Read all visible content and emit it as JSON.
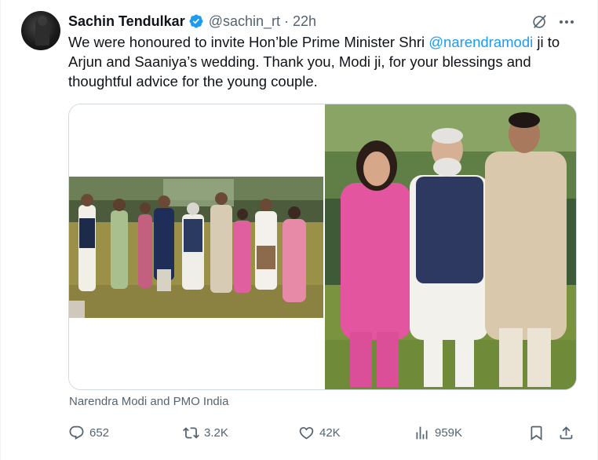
{
  "tweet": {
    "author_name": "Sachin Tendulkar",
    "handle": "@sachin_rt",
    "separator": "·",
    "time": "22h",
    "text_part1": "We were honoured to invite Hon’ble Prime Minister Shri ",
    "mention": "@narendramodi",
    "text_part2": " ji to Arjun and Saaniya’s wedding. Thank you, Modi ji, for your blessings and thoughtful advice for the young couple.",
    "media_caption": "Narendra Modi and PMO India"
  },
  "actions": {
    "replies": "652",
    "reposts": "3.2K",
    "likes": "42K",
    "views": "959K"
  },
  "colors": {
    "accent": "#1d9bf0",
    "muted": "#536471",
    "text": "#0f1419",
    "border": "#cfd9de"
  },
  "icons": {
    "verified": "verified-badge-icon",
    "grok": "grok-icon",
    "more": "more-icon",
    "reply": "reply-icon",
    "repost": "repost-icon",
    "like": "heart-icon",
    "views": "views-icon",
    "bookmark": "bookmark-icon",
    "share": "share-icon"
  }
}
